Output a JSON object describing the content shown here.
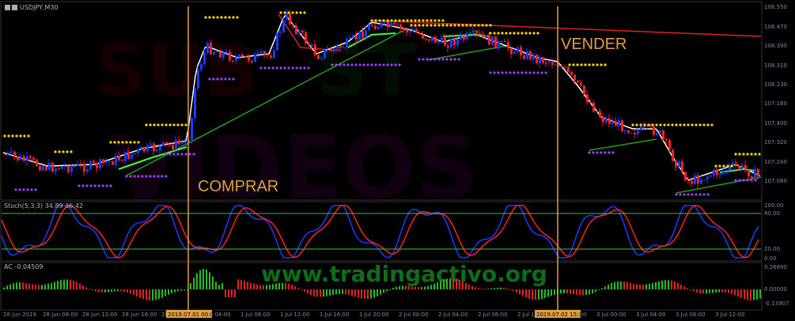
{
  "window": {
    "symbol_title": "USDJPY,M30",
    "icons": [
      "chart-window-icon",
      "chart-window-icon"
    ]
  },
  "watermark": {
    "line1": "www.tradingactivo.org"
  },
  "annotations": {
    "buy": "COMPRAR",
    "sell": "VENDER"
  },
  "subwindows": {
    "stochastic_title": "Stoch(5,3,3) 34.89 36.42",
    "ac_title": "AC -0.04509"
  },
  "price_axis": [
    "108.550",
    "108.470",
    "108.390",
    "108.310",
    "108.230",
    "107.160",
    "108.025",
    "107.400",
    "107.320",
    "107.240",
    "107.160",
    "107.080"
  ],
  "stoch_axis": [
    "100.00",
    "80.00",
    "20.00",
    "0.00"
  ],
  "ac_axis": [
    "0.26890",
    "0.00000",
    "-0.13907"
  ],
  "time_axis": [
    "28 Jun 2019",
    "28 Jun 08:00",
    "28 Jun 12:00",
    "28 Jun 16:00",
    "28 Jun 20:00",
    "1 Jul 04:00",
    "1 Jul 08:00",
    "1 Jul 12:00",
    "1 Jul 16:00",
    "1 Jul 20:00",
    "2 Jul 00:00",
    "2 Jul 04:00",
    "2 Jul 08:00",
    "2 Jul 12:00",
    "2 Jul 20:00",
    "3 Jul 00:00",
    "3 Jul 04:00",
    "3 Jul 08:00",
    "3 Jul 12:00"
  ],
  "time_badges": {
    "buy": "2019.07.01 00:00",
    "sell": "2019.07.02 15:30"
  },
  "colors": {
    "bull": "#1a3cff",
    "bear": "#ff2020",
    "resistance": "#ffd700",
    "support": "#9a40ff",
    "ma": "#ffffff",
    "ma_up": "#40ff40",
    "vline": "#e0a040",
    "stoch_k": "#1a3cff",
    "stoch_d": "#ff2020",
    "level": "#40c040"
  }
}
